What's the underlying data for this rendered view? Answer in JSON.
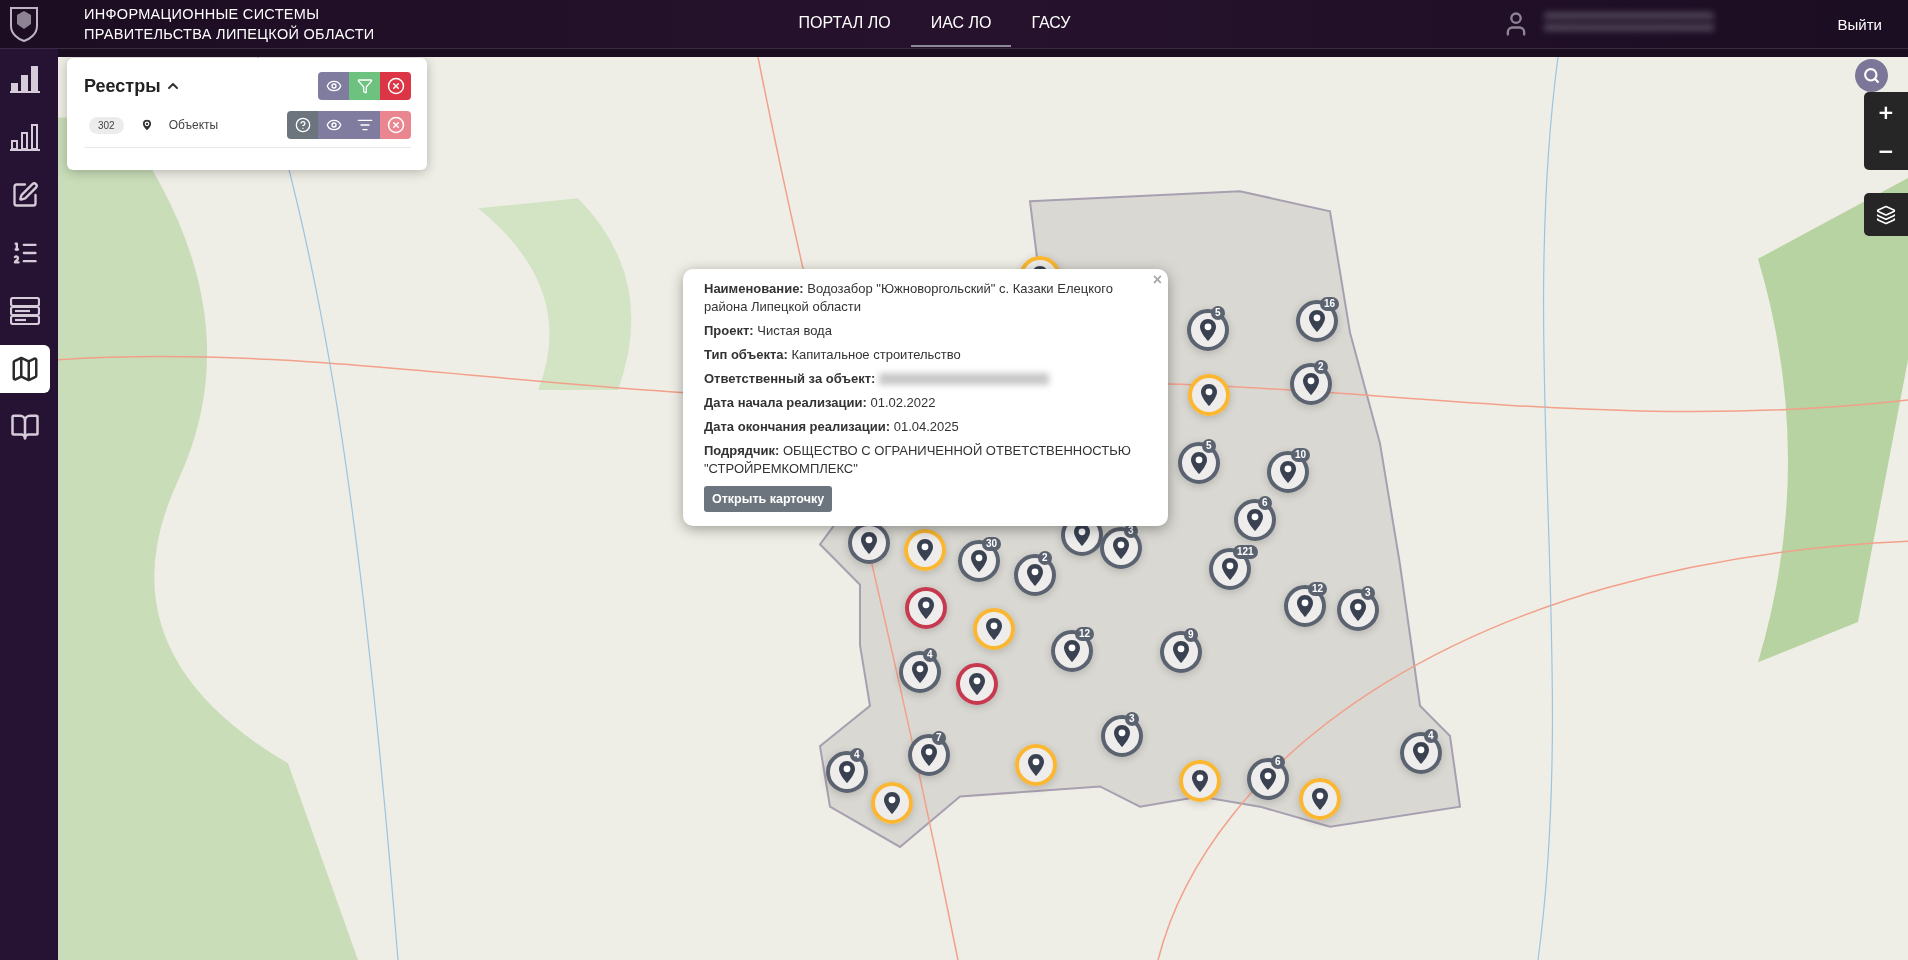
{
  "header": {
    "title_lines": [
      "ИНФОРМАЦИОННЫЕ СИСТЕМЫ",
      "ПРАВИТЕЛЬСТВА ЛИПЕЦКОЙ ОБЛАСТИ"
    ],
    "nav": [
      {
        "label": "ПОРТАЛ ЛО",
        "selected": false
      },
      {
        "label": "ИАС ЛО",
        "selected": true
      },
      {
        "label": "ГАСУ",
        "selected": false
      }
    ],
    "user": {
      "redacted": true
    },
    "logout": "Выйти"
  },
  "sidebar": {
    "items": [
      {
        "kind": "bars-filled",
        "selected": false
      },
      {
        "kind": "bars-outline",
        "selected": false
      },
      {
        "kind": "edit",
        "selected": false
      },
      {
        "kind": "list",
        "selected": false
      },
      {
        "kind": "rows",
        "selected": false
      },
      {
        "kind": "map",
        "selected": true
      },
      {
        "kind": "book",
        "selected": false
      }
    ]
  },
  "registry_panel": {
    "title": "Реестры",
    "expanded": true,
    "rows": [
      {
        "count": "302",
        "label": "Объекты"
      }
    ]
  },
  "map_controls": {
    "zoom_in": "+",
    "zoom_out": "−"
  },
  "markers": [
    {
      "color": "#fbb731"
    },
    {
      "color": "#5b6270",
      "count": "5"
    },
    {
      "color": "#5b6270",
      "count": "16"
    },
    {
      "color": "#fbb731"
    },
    {
      "color": "#5b6270",
      "count": "2"
    },
    {
      "color": "#5b6270",
      "count": "5"
    },
    {
      "color": "#5b6270",
      "count": "10"
    },
    {
      "color": "#5b6270",
      "count": "6"
    },
    {
      "color": "#5b6270"
    },
    {
      "color": "#fbb731"
    },
    {
      "color": "#5b6270",
      "count": "30"
    },
    {
      "color": "#5b6270"
    },
    {
      "color": "#5b6270",
      "count": "3"
    },
    {
      "color": "#5b6270",
      "count": "2"
    },
    {
      "color": "#5b6270",
      "count": "121"
    },
    {
      "color": "#c7394f"
    },
    {
      "color": "#fbb731"
    },
    {
      "color": "#5b6270",
      "count": "12"
    },
    {
      "color": "#5b6270",
      "count": "9"
    },
    {
      "color": "#5b6270",
      "count": "12"
    },
    {
      "color": "#5b6270",
      "count": "3"
    },
    {
      "color": "#5b6270",
      "count": "4"
    },
    {
      "color": "#c7394f"
    },
    {
      "color": "#5b6270",
      "count": "3"
    },
    {
      "color": "#5b6270",
      "count": "7"
    },
    {
      "color": "#fbb731"
    },
    {
      "color": "#5b6270",
      "count": "4"
    },
    {
      "color": "#fbb731"
    },
    {
      "color": "#fbb731"
    },
    {
      "color": "#5b6270",
      "count": "6"
    },
    {
      "color": "#fbb731"
    },
    {
      "color": "#5b6270",
      "count": "4"
    }
  ],
  "popup": {
    "close": "×",
    "fields": [
      {
        "text": "**Наименование:** Водозабор \"Южноворгольский\" с. Казаки Елецкого района Липецкой области",
        "redacted": false
      },
      {
        "text": "**Проект:** Чистая вода",
        "redacted": false
      },
      {
        "text": "**Тип объекта:** Капитальное строительство",
        "redacted": false
      },
      {
        "text": "**Ответственный за объект:**",
        "redacted": true
      },
      {
        "text": "**Дата начала реализации:** 01.02.2022",
        "redacted": false
      },
      {
        "text": "**Дата окончания реализации:** 01.04.2025",
        "redacted": false
      },
      {
        "text": "**Подрядчик:** ОБЩЕСТВО С ОГРАНИЧЕННОЙ ОТВЕТСТВЕННОСТЬЮ \"СТРОЙРЕМКОМПЛЕКС\"",
        "redacted": false
      }
    ],
    "button": "Открыть карточку"
  }
}
